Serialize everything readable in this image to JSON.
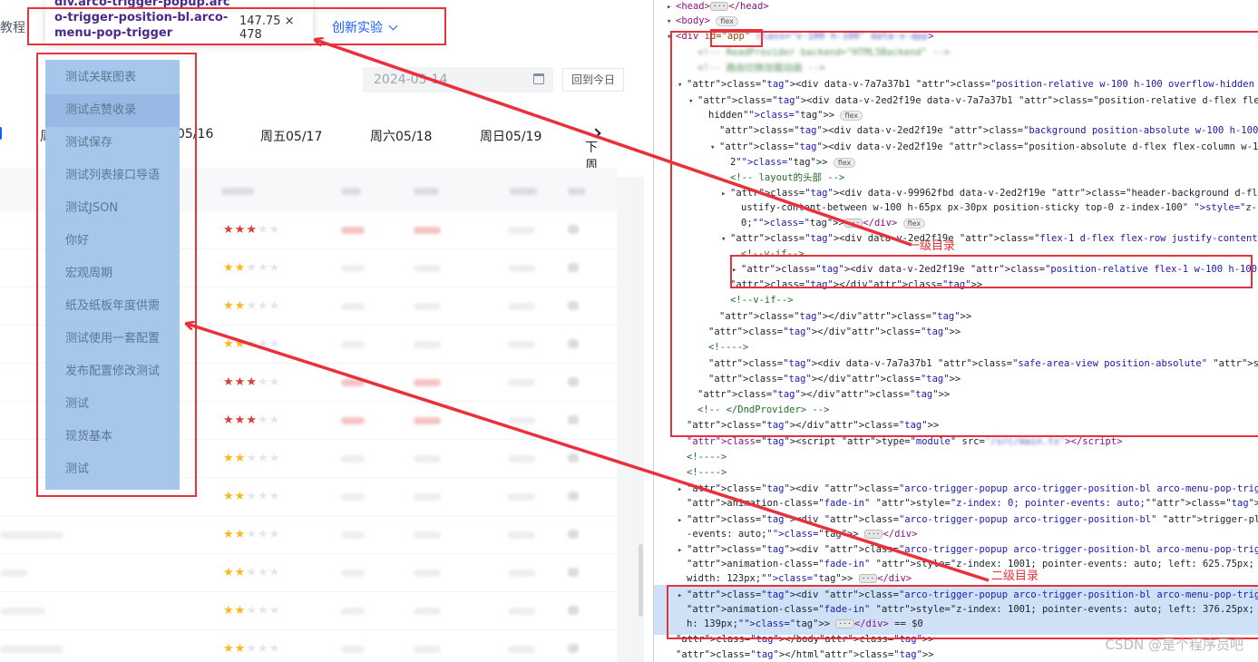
{
  "left": {
    "topbar_label": "教程",
    "topbar_menu": "创新实验",
    "tooltip_name": "div.arco-trigger-popup.arco-trigger-position-bl.arco-menu-pop-trigger",
    "tooltip_size": "147.75 × 478",
    "date_value": "2024-05-14",
    "today_button": "回到今日",
    "week": {
      "d1": "周",
      "d2": "05/16",
      "d3": "周五05/17",
      "d4": "周六05/18",
      "d5": "周日05/19",
      "next": "下周"
    },
    "menu_items": [
      "测试关联图表",
      "测试点赞收录",
      "测试保存",
      "测试列表接口导语",
      "测试JSON",
      "你好",
      "宏观周期",
      "纸及纸板年度供需",
      "测试使用一套配置",
      "发布配置修改测试",
      "测试",
      "现货基本",
      "测试"
    ],
    "rows": [
      {
        "stars": 3,
        "red": true
      },
      {
        "stars": 2,
        "red": false
      },
      {
        "stars": 2,
        "red": false
      },
      {
        "stars": 2,
        "red": false
      },
      {
        "stars": 3,
        "red": true
      },
      {
        "stars": 3,
        "red": true
      },
      {
        "stars": 2,
        "red": false
      },
      {
        "stars": 2,
        "red": false
      },
      {
        "stars": 2,
        "red": false
      },
      {
        "stars": 2,
        "red": false
      },
      {
        "stars": 2,
        "red": false
      },
      {
        "stars": 2,
        "red": false
      }
    ]
  },
  "devtools": {
    "head": "<head>",
    "head_close": "</head>",
    "body": "<body>",
    "flex": "flex",
    "app_id": "id=\"app\"",
    "comment_layout": "<!-- layout的头部 -->",
    "comment_vif": "<!--v-if-->",
    "comment_empty": "<!---->",
    "comment_dnd": "<!-- </DndProvider> -->",
    "script_line": "<script type=\"module\" src=",
    "annotation_level1": "一级目录",
    "annotation_level2": "二级目录",
    "selected_suffix": "== $0",
    "lines": [
      "<div data-v-7a7a37b1 class=\"position-relative w-100 h-100 overflow-hidden pc pc-scrollbar\">",
      "<div data-v-2ed2f19e data-v-7a7a37b1 class=\"position-relative d-flex flex-column w-100 h-100 overflow-",
      "hidden\">",
      "<div data-v-2ed2f19e class=\"background position-absolute w-100 h-100 z-index-1 background\"></div>",
      "<div data-v-2ed2f19e class=\"position-absolute d-flex flex-column w-100 h-100 overflow-auto z-index-",
      "2\">",
      "<div data-v-99962fbd data-v-2ed2f19e class=\"header-background d-flex flex-row align-items-center j",
      "ustify-content-between w-100 h-65px px-30px position-sticky top-0 z-index-100\" style=\"z-index: 20",
      "0;\">",
      "<div data-v-2ed2f19e class=\"flex-1 d-flex flex-row justify-content-between overflow-hidden\">",
      "<div data-v-2ed2f19e class=\"position-relative flex-1 w-100 h-100 overflow-hidden\">",
      "</div>",
      "</div>",
      "</div>",
      "<div data-v-7a7a37b1 class=\"safe-area-view position-absolute\" style=\"top: -99999px; left: -99999px;\">",
      "</div>",
      "</div>",
      "<div class=\"arco-trigger-popup arco-trigger-position-bl arco-menu-pop-trigger\" trigger-placement=\"bl\"",
      "animation-class=\"fade-in\" style=\"z-index: 0; pointer-events: auto;\">",
      "<div class=\"arco-trigger-popup arco-trigger-position-bl\" trigger-placement=\"bl\" style=\"z-index: 0; pointer",
      "-events: auto;\">",
      "<div class=\"arco-trigger-popup arco-trigger-position-bl arco-menu-pop-trigger\" trigger-placement=\"bl\"",
      "animation-class=\"fade-in\" style=\"z-index: 1001; pointer-events: auto; left: 625.75px; top: 114.375px; min-",
      "width: 123px;\">",
      "<div class=\"arco-trigger-popup arco-trigger-position-bl arco-menu-pop-trigger\" trigger-placement=\"bl\"",
      "animation-class=\"fade-in\" style=\"z-index: 1001; pointer-events: auto; left: 376.25px; top: 113px; min-wi",
      "h: 139px;\">",
      "</body>",
      "</html>"
    ],
    "watermark": "CSDN @是个程序员吧"
  },
  "colors": {
    "annotation_red": "#e8313a",
    "menu_bg": "#a7c6ec",
    "selected_row": "#cfe1f7",
    "link_blue": "#165dff"
  }
}
